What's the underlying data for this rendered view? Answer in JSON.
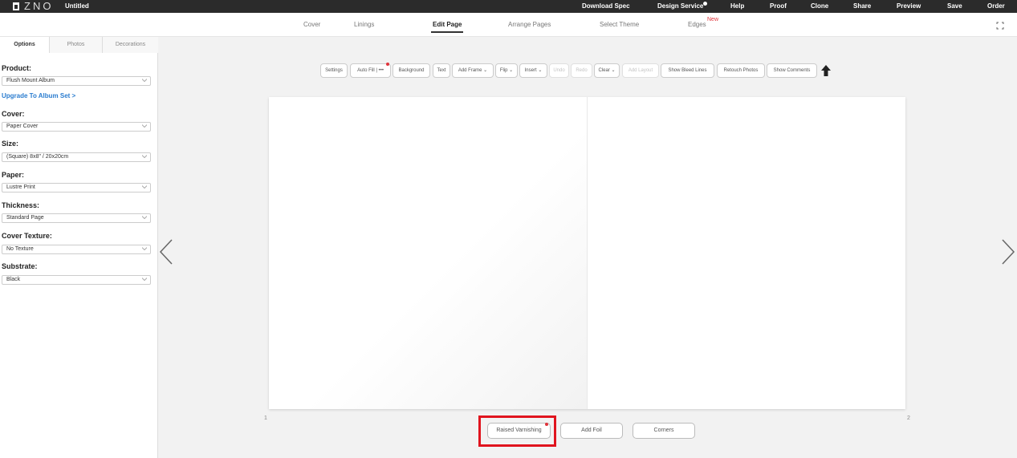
{
  "topbar": {
    "logo_text": "ZNO",
    "title": "Untitled",
    "nav": {
      "download_spec": "Download Spec",
      "design_service": "Design Service",
      "help": "Help",
      "proof": "Proof",
      "clone": "Clone",
      "share": "Share",
      "preview": "Preview",
      "save": "Save",
      "order": "Order"
    }
  },
  "steps": {
    "cover": "Cover",
    "linings": "Linings",
    "edit_page": "Edit Page",
    "arrange_pages": "Arrange Pages",
    "select_theme": "Select Theme",
    "edges": "Edges",
    "new_badge": "New",
    "active": "Edit Page"
  },
  "sidebar": {
    "tabs": {
      "options": "Options",
      "photos": "Photos",
      "decorations": "Decorations"
    },
    "fields": {
      "product": {
        "label": "Product:",
        "value": "Flush Mount Album"
      },
      "upgrade_link": "Upgrade To Album Set >",
      "cover": {
        "label": "Cover:",
        "value": "Paper Cover"
      },
      "size": {
        "label": "Size:",
        "value": "(Square) 8x8\" / 20x20cm"
      },
      "paper": {
        "label": "Paper:",
        "value": "Lustre Print"
      },
      "thickness": {
        "label": "Thickness:",
        "value": "Standard Page"
      },
      "cover_texture": {
        "label": "Cover Texture:",
        "value": "No Texture"
      },
      "substrate": {
        "label": "Substrate:",
        "value": "Black"
      }
    }
  },
  "toolbar": {
    "settings": "Settings",
    "auto_fill": "Auto Fill | •••",
    "background": "Background",
    "text": "Text",
    "add_frame": "Add Frame ⌄",
    "flip": "Flip ⌄",
    "insert": "Insert ⌄",
    "undo": "Undo",
    "redo": "Redo",
    "clear": "Clear ⌄",
    "add_layout": "Add Layout",
    "show_bleed_lines": "Show Bleed Lines",
    "retouch_photos": "Retouch Photos",
    "show_comments": "Show Comments"
  },
  "canvas": {
    "left_page_number": "1",
    "right_page_number": "2"
  },
  "bottom": {
    "raised_varnishing": "Raised Varnishing",
    "add_foil": "Add Foil",
    "corners": "Corners"
  },
  "colors": {
    "topbar_bg": "#2b2b2b",
    "accent_red": "#e0333b",
    "link_blue": "#2a7ccf",
    "highlight_red": "#e0141e"
  }
}
